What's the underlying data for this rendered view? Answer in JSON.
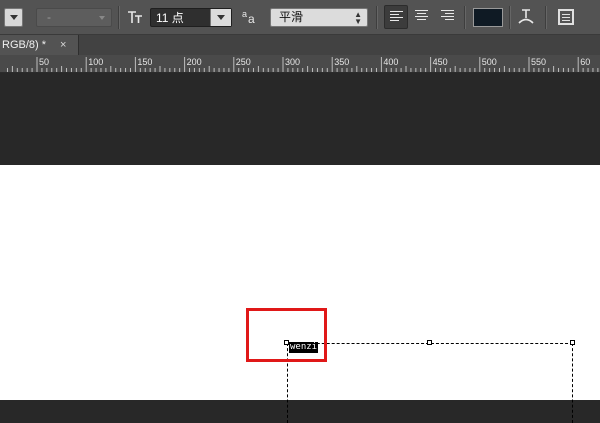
{
  "toolbar": {
    "font_style_value": "-",
    "size_icon": "text-size-icon",
    "font_size_value": "11 点",
    "antialias_icon": "antialias-icon",
    "antialias_value": "平滑",
    "align_left_icon": "align-left-icon",
    "align_center_icon": "align-center-icon",
    "align_right_icon": "align-right-icon",
    "text_color": "#0f1a24",
    "warp_icon": "warp-text-icon",
    "panels_icon": "character-panel-icon"
  },
  "document_tab": {
    "title": "RGB/8) *",
    "close_label": "×"
  },
  "ruler": {
    "labels": [
      "50",
      "100",
      "150",
      "200",
      "250",
      "300",
      "350",
      "400",
      "450",
      "500",
      "550",
      "60"
    ]
  },
  "canvas": {
    "typed_text": "wenzi",
    "highlight_color": "#e01818"
  }
}
